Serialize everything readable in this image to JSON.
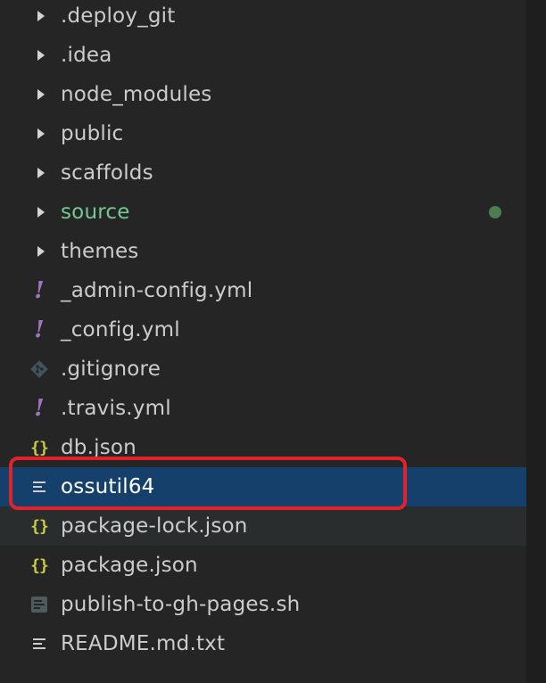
{
  "explorer": {
    "items": [
      {
        "label": ".deploy_git",
        "type": "folder"
      },
      {
        "label": ".idea",
        "type": "folder"
      },
      {
        "label": "node_modules",
        "type": "folder"
      },
      {
        "label": "public",
        "type": "folder"
      },
      {
        "label": "scaffolds",
        "type": "folder"
      },
      {
        "label": "source",
        "type": "folder",
        "status": "modified-green"
      },
      {
        "label": "themes",
        "type": "folder"
      },
      {
        "label": "_admin-config.yml",
        "type": "yml",
        "icon": "yaml-exclamation-icon"
      },
      {
        "label": "_config.yml",
        "type": "yml",
        "icon": "yaml-exclamation-icon"
      },
      {
        "label": ".gitignore",
        "type": "git",
        "icon": "git-icon"
      },
      {
        "label": ".travis.yml",
        "type": "yml",
        "icon": "yaml-exclamation-icon"
      },
      {
        "label": "db.json",
        "type": "json",
        "icon": "json-braces-icon"
      },
      {
        "label": "ossutil64",
        "type": "text",
        "icon": "text-lines-icon",
        "selected": true
      },
      {
        "label": "package-lock.json",
        "type": "json",
        "icon": "json-braces-icon",
        "hover": true
      },
      {
        "label": "package.json",
        "type": "json",
        "icon": "json-braces-icon"
      },
      {
        "label": "publish-to-gh-pages.sh",
        "type": "shell",
        "icon": "terminal-file-icon"
      },
      {
        "label": "README.md.txt",
        "type": "text",
        "icon": "text-lines-icon"
      }
    ],
    "icons": {
      "yml": "!",
      "json": "{}"
    }
  },
  "colors": {
    "background": "#252526",
    "selected_row": "#15406b",
    "hover_row": "#2a2d2e",
    "text": "#cccccc",
    "modified_green": "#73c991",
    "annotation_red": "#e0222a"
  }
}
